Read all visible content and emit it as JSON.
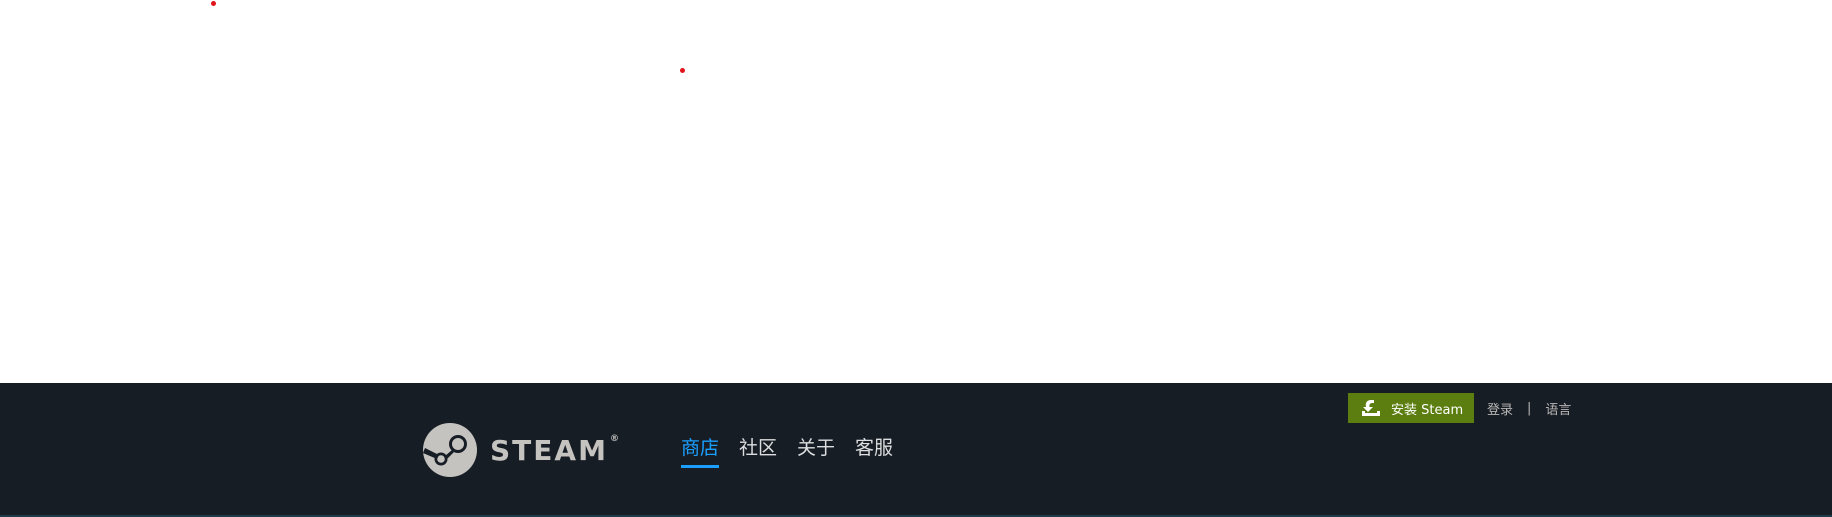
{
  "header": {
    "logo": {
      "wordmark": "STEAM",
      "registered": "®",
      "icon": "steam-logo-icon"
    },
    "nav": [
      {
        "label": "商店",
        "active": true
      },
      {
        "label": "社区",
        "active": false
      },
      {
        "label": "关于",
        "active": false
      },
      {
        "label": "客服",
        "active": false
      }
    ],
    "install_button": {
      "label": "安装 Steam",
      "icon": "download-icon"
    },
    "login_link": "登录",
    "separator": "|",
    "language_link": "语言"
  },
  "colors": {
    "header_bg": "#171d25",
    "active_nav": "#1a9fff",
    "install_bg": "#5c7e10",
    "marker": "#e1141b"
  }
}
